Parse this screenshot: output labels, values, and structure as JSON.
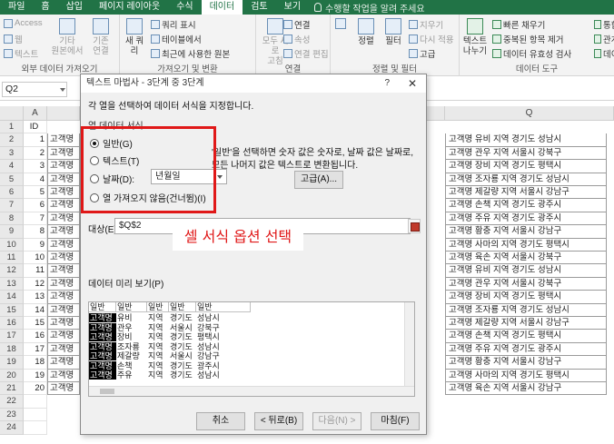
{
  "ribbon": {
    "tabs": [
      "파일",
      "홈",
      "삽입",
      "페이지 레이아웃",
      "수식",
      "데이터",
      "검토",
      "보기"
    ],
    "active_tab": "데이터",
    "tell_me": "수행할 작업을 알려 주세요",
    "get_external": {
      "access": "Access",
      "web": "웹",
      "text": "텍스트",
      "other": "기타",
      "other2": "원본에서",
      "existing": "기존",
      "existing2": "연결",
      "label": "외부 데이터 가져오기"
    },
    "get_transform": {
      "new_query": "새 쿼",
      "new_query2": "리",
      "show_queries": "쿼리 표시",
      "from_table": "테이블에서",
      "recent_sources": "최근에 사용한 원본",
      "label": "가져오기 및 변환"
    },
    "connections": {
      "refresh_all": "모두 새로",
      "refresh_all2": "고침",
      "connections": "연결",
      "properties": "속성",
      "edit_links": "연결 편집",
      "label": "연결"
    },
    "sort_filter": {
      "sort": "정렬",
      "filter": "필터",
      "clear": "지우기",
      "reapply": "다시 적용",
      "advanced": "고급",
      "label": "정렬 및 필터"
    },
    "data_tools": {
      "text_to_columns": "텍스트",
      "text_to_columns2": "나누기",
      "flash_fill": "빠른 채우기",
      "remove_duplicates": "중복된 항목 제거",
      "data_validation": "데이터 유효성 검사",
      "consolidate": "통합",
      "relationships": "관계",
      "data_model": "데이",
      "label": "데이터 도구"
    }
  },
  "formula_bar": {
    "name_box": "Q2"
  },
  "sheet": {
    "col_a": "A",
    "col_q": "Q",
    "row_numbers": [
      "1",
      "2",
      "3",
      "4",
      "5",
      "6",
      "7",
      "8",
      "9",
      "10",
      "11",
      "12",
      "13",
      "14",
      "15",
      "16",
      "17",
      "18",
      "19",
      "20",
      "21",
      "22",
      "23",
      "24"
    ],
    "col_a_values": [
      "ID",
      "1",
      "2",
      "3",
      "4",
      "5",
      "6",
      "7",
      "8",
      "9",
      "10",
      "11",
      "12",
      "13",
      "14",
      "15",
      "16",
      "17",
      "18",
      "19",
      "20",
      "",
      "",
      ""
    ],
    "col_b_value": "고객명",
    "col_q_values": [
      "고객명 유비 지역 경기도 성남시",
      "고객명 관우 지역 서울시 강북구",
      "고객명 장비 지역 경기도 평택시",
      "고객명 조자룡 지역 경기도 성남시",
      "고객명 제갈량 지역 서울시 강남구",
      "고객명 손책 지역 경기도 광주시",
      "고객명 주유 지역 경기도 광주시",
      "고객명 황충 지역 서울시 강남구",
      "고객명 사마의 지역 경기도 평택시",
      "고객명 육손 지역 서울시 강북구",
      "고객명 유비 지역 경기도 성남시",
      "고객명 관우 지역 서울시 강북구",
      "고객명 장비 지역 경기도 평택시",
      "고객명 조자룡 지역 경기도 성남시",
      "고객명 제갈량 지역 서울시 강남구",
      "고객명 손책 지역 경기도 평택시",
      "고객명 주유 지역 경기도 광주시",
      "고객명 황충 지역 서울시 강남구",
      "고객명 사마의 지역 경기도 평택시",
      "고객명 육손 지역 서울시 강남구"
    ]
  },
  "dialog": {
    "title": "텍스트 마법사 - 3단계 중 3단계",
    "help": "?",
    "close": "✕",
    "instruction": "각 열을 선택하여 데이터 서식을 지정합니다.",
    "column_format_label": "열 데이터 서식",
    "options": [
      "일반(G)",
      "텍스트(T)",
      "날짜(D):",
      "열 가져오지 않음(건너뜀)(I)"
    ],
    "selected_option": 0,
    "date_format": "년월일",
    "desc_line1": "'일반'을 선택하면 숫자 값은 숫자로, 날짜 값은 날짜로,",
    "desc_line2": "모든 나머지 값은 텍스트로 변환됩니다.",
    "advanced": "고급(A)...",
    "destination_label": "대상(E):",
    "destination_value": "$Q$2",
    "preview_label": "데이터 미리 보기(P)",
    "preview_headers": [
      "일반",
      "일반",
      "일반",
      "일반",
      "일반"
    ],
    "preview_rows": [
      [
        "고객명",
        "유비",
        "지역",
        "경기도",
        "성남시"
      ],
      [
        "고객명",
        "관우",
        "지역",
        "서울시",
        "강북구"
      ],
      [
        "고객명",
        "장비",
        "지역",
        "경기도",
        "평택시"
      ],
      [
        "고객명",
        "조자룡",
        "지역",
        "경기도",
        "성남시"
      ],
      [
        "고객명",
        "제갈량",
        "지역",
        "서울시",
        "강남구"
      ],
      [
        "고객명",
        "손책",
        "지역",
        "경기도",
        "광주시"
      ],
      [
        "고객명",
        "주유",
        "지역",
        "경기도",
        "성남시"
      ]
    ],
    "buttons": {
      "cancel": "취소",
      "back": "< 뒤로(B)",
      "next": "다음(N) >",
      "finish": "마침(F)"
    }
  },
  "annotation": {
    "label": "셀 서식 옵션 선택",
    "color": "#e01818"
  }
}
